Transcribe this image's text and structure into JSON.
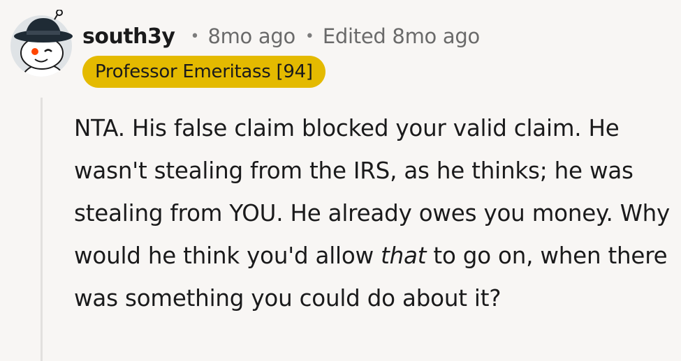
{
  "comment": {
    "username": "south3y",
    "separator": "•",
    "posted": "8mo ago",
    "edited": "Edited 8mo ago",
    "flair": "Professor Emeritass [94]",
    "body_before_italic": "NTA. His false claim blocked your valid claim. He wasn't stealing from the IRS, as he thinks; he was stealing from YOU. He already owes you money. Why would he think you'd allow ",
    "body_italic": "that",
    "body_after_italic": " to go on, when there was something you could do about it?"
  },
  "avatar": {
    "icon": "snoo-avatar-icon",
    "hat_color": "#1f2b35",
    "face_color": "#ffffff"
  },
  "colors": {
    "background": "#f8f6f4",
    "flair_background": "#e4ba00",
    "thread_line": "#e2e0de",
    "meta_text": "#6a6a6a"
  }
}
